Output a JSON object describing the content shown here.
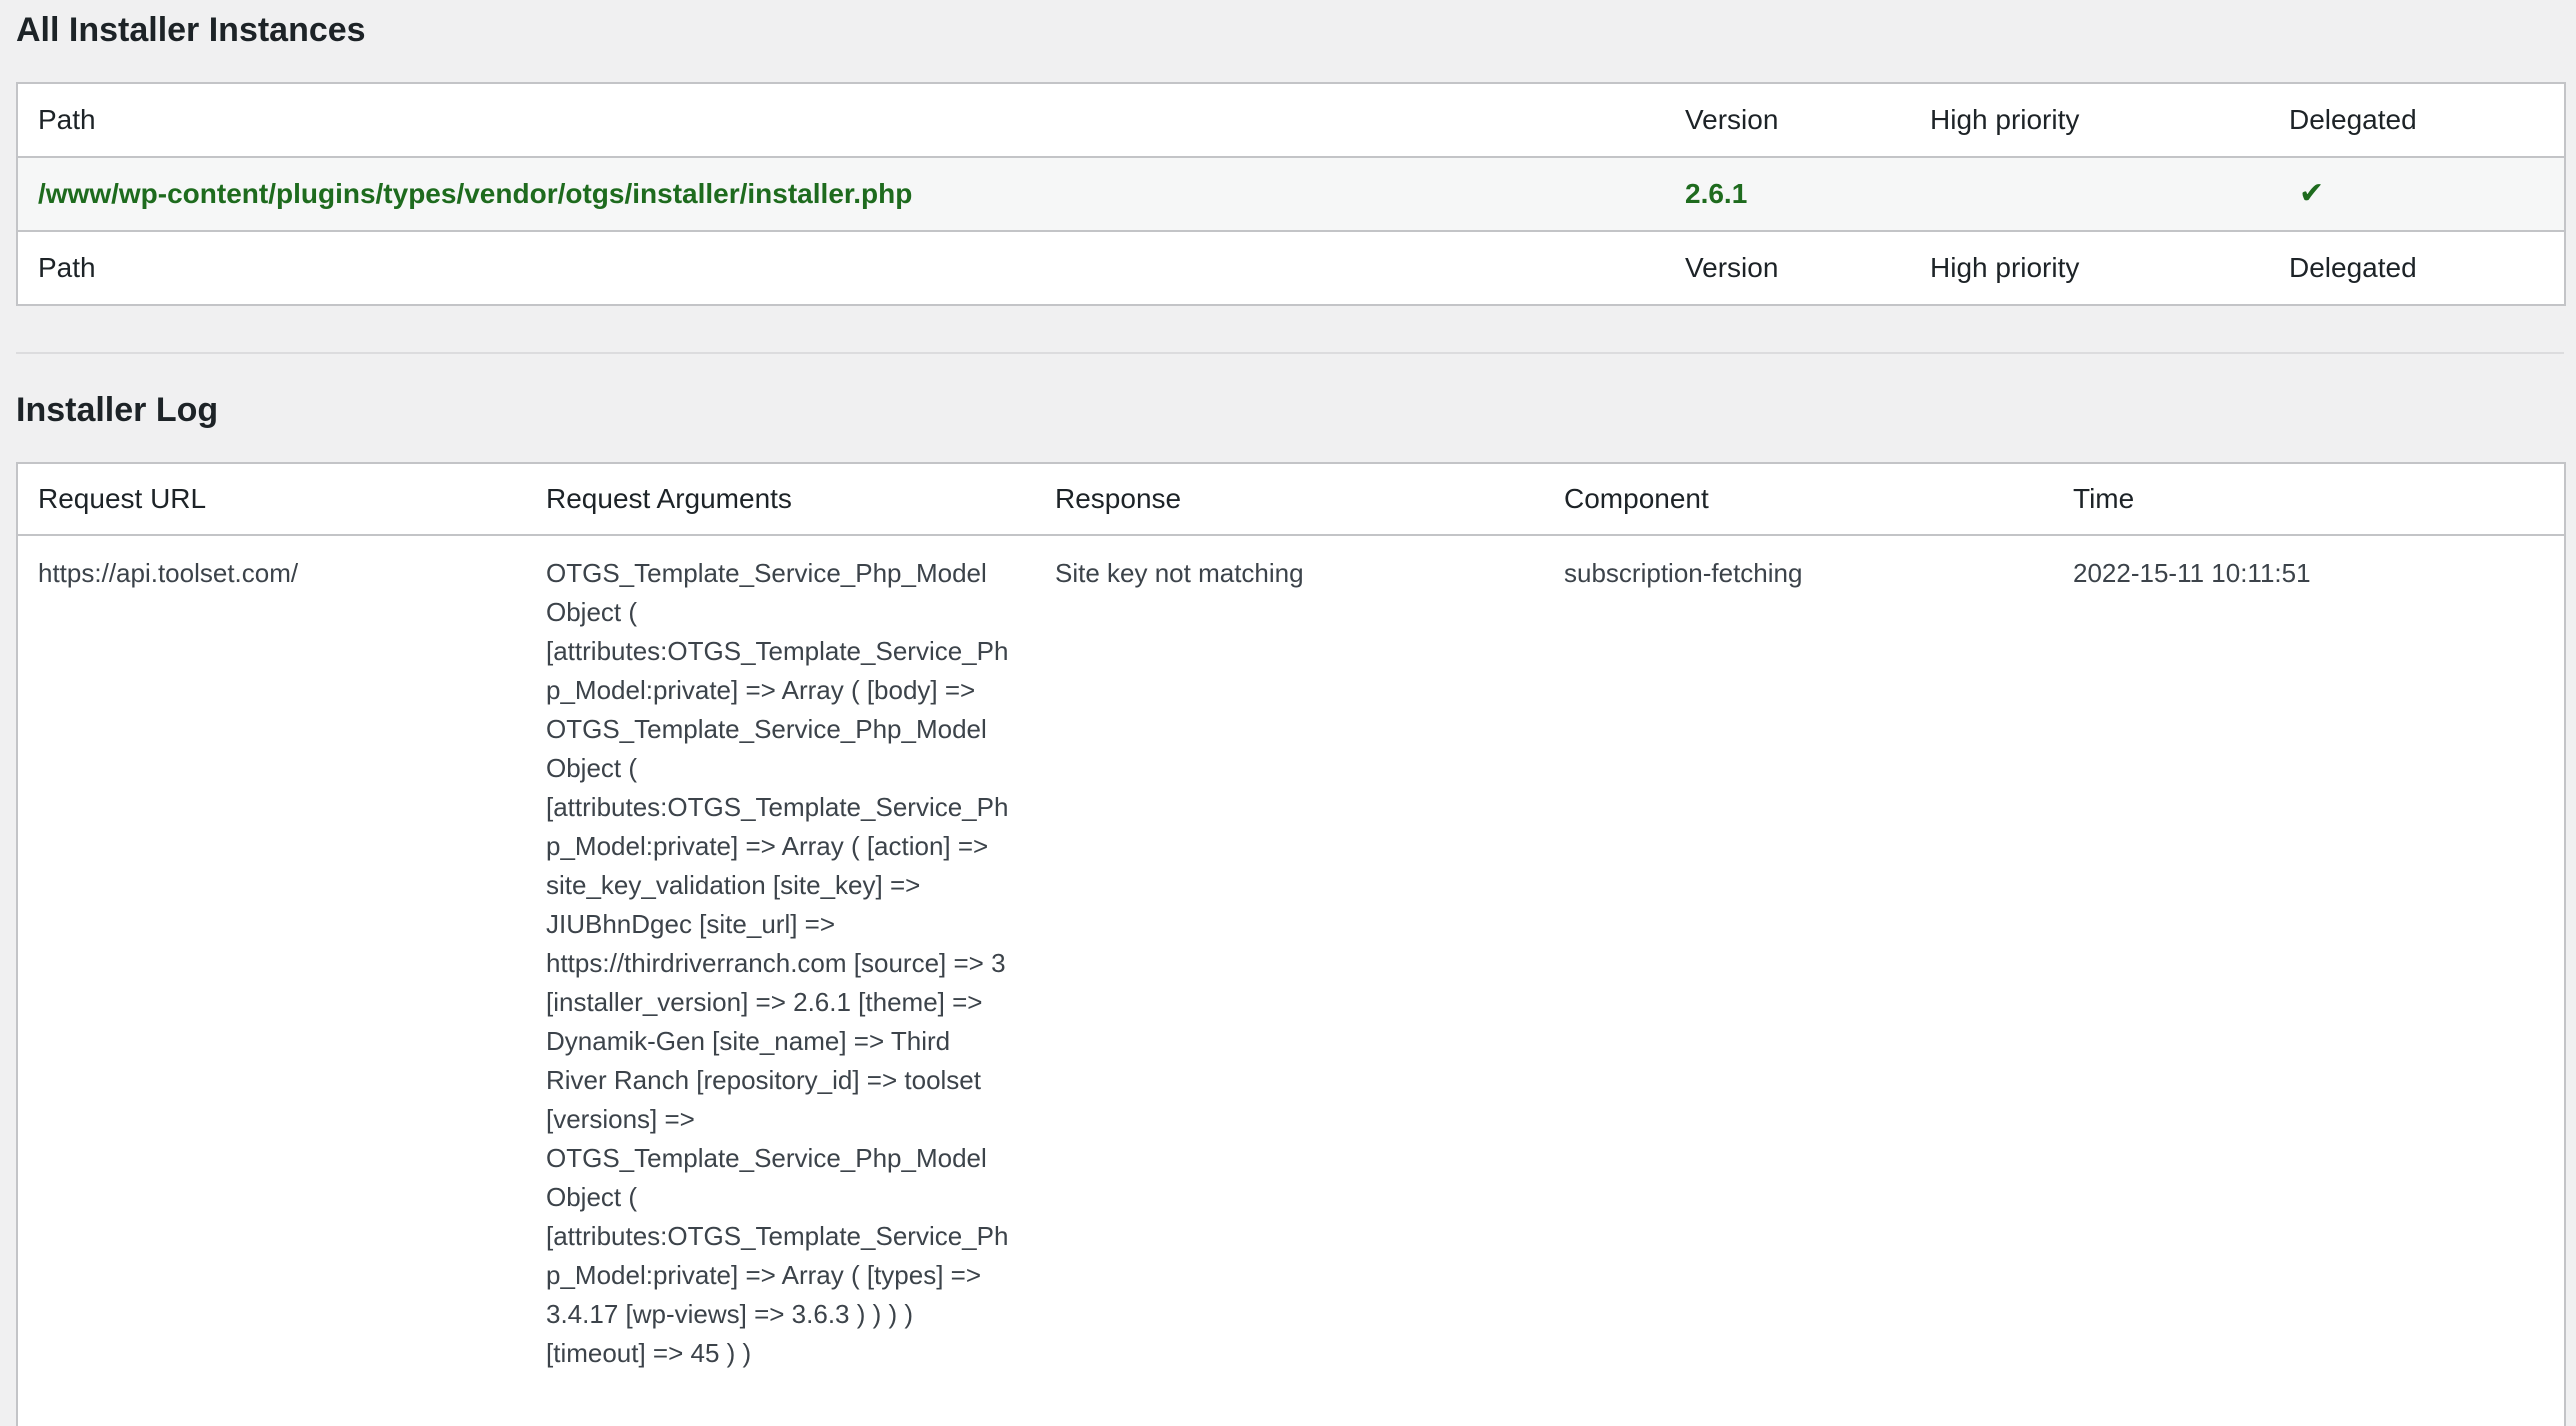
{
  "instances_section": {
    "title": "All Installer Instances",
    "columns": {
      "path": "Path",
      "version": "Version",
      "high_priority": "High priority",
      "delegated": "Delegated"
    },
    "rows": [
      {
        "path": "/www/wp-content/plugins/types/vendor/otgs/installer/installer.php",
        "version": "2.6.1",
        "high_priority": "",
        "delegated": "✔"
      }
    ]
  },
  "log_section": {
    "title": "Installer Log",
    "columns": {
      "request_url": "Request URL",
      "request_arguments": "Request Arguments",
      "response": "Response",
      "component": "Component",
      "time": "Time"
    },
    "rows": [
      {
        "request_url": "https://api.toolset.com/",
        "request_arguments": "OTGS_Template_Service_Php_Model Object ( [attributes:OTGS_Template_Service_Php_Model:private] => Array ( [body] => OTGS_Template_Service_Php_Model Object ( [attributes:OTGS_Template_Service_Php_Model:private] => Array ( [action] => site_key_validation [site_key] => JIUBhnDgec [site_url] => https://thirdriverranch.com [source] => 3 [installer_version] => 2.6.1 [theme] => Dynamik-Gen [site_name] => Third River Ranch [repository_id] => toolset [versions] => OTGS_Template_Service_Php_Model Object ( [attributes:OTGS_Template_Service_Php_Model:private] => Array ( [types] => 3.4.17 [wp-views] => 3.6.3 ) ) ) ) [timeout] => 45 ) )",
        "response": "Site key not matching",
        "component": "subscription-fetching",
        "time": "2022-15-11 10:11:51"
      }
    ]
  }
}
